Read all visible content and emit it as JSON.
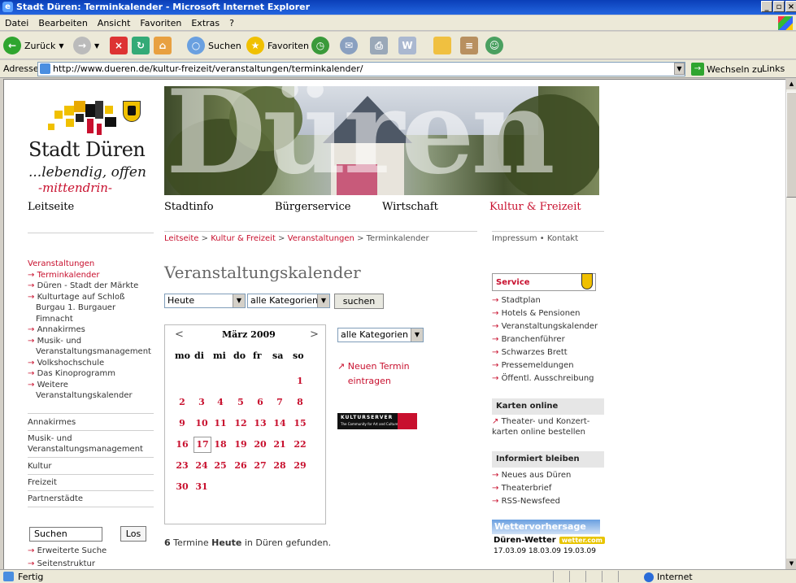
{
  "window": {
    "title": "Stadt Düren: Terminkalender - Microsoft Internet Explorer"
  },
  "menu": [
    "Datei",
    "Bearbeiten",
    "Ansicht",
    "Favoriten",
    "Extras",
    "?"
  ],
  "toolbar": {
    "back": "Zurück",
    "search": "Suchen",
    "favorites": "Favoriten"
  },
  "address": {
    "label": "Adresse",
    "url": "http://www.dueren.de/kultur-freizeit/veranstaltungen/terminkalender/",
    "go": "Wechseln zu",
    "links": "Links"
  },
  "status": {
    "text": "Fertig",
    "zone": "Internet"
  },
  "logo": {
    "name": "Stadt Düren",
    "slogan1": "...lebendig, offen",
    "slogan2": "-mittendrin-"
  },
  "banner": {
    "word": "Düren"
  },
  "topnav": {
    "home": "Leitseite",
    "stadtinfo": "Stadtinfo",
    "buerger": "Bürgerservice",
    "wirtschaft": "Wirtschaft",
    "kultur": "Kultur & Freizeit"
  },
  "breadcrumb": {
    "home": "Leitseite",
    "kultur": "Kultur & Freizeit",
    "veranst": "Veranstaltungen",
    "sep": " > ",
    "current": "Terminkalender"
  },
  "rightlinks": "Impressum • Kontakt",
  "leftnav": {
    "heading": "Veranstaltungen",
    "items": [
      "Terminkalender",
      "Düren - Stadt der Märkte",
      "Kulturtage auf Schloß Burgau 1. Burgauer Fimnacht",
      "Annakirmes",
      "Musik- und Veranstaltungsmanagement",
      "Volkshochschule",
      "Das Kinoprogramm",
      "Weitere Veranstaltungskalender"
    ],
    "sections": [
      "Annakirmes",
      "Musik- und Veranstaltungsmanagement",
      "Kultur",
      "Freizeit",
      "Partnerstädte"
    ]
  },
  "search": {
    "value": "Suchen",
    "button": "Los",
    "links": [
      "Erweiterte Suche",
      "Seitenstruktur"
    ]
  },
  "main": {
    "title": "Veranstaltungskalender",
    "period": "Heute",
    "category": "alle Kategorien",
    "submit": "suchen",
    "category2": "alle Kategorien",
    "new_event_arrow": "↗",
    "new_event": "Neuen Termin eintragen",
    "found_count": "6",
    "found_mid": " Termine ",
    "found_today": "Heute",
    "found_end": " in Düren gefunden."
  },
  "kulturserver": {
    "name": "KULTURSERVER",
    "sub": "The Community for Art and Culture"
  },
  "calendar": {
    "month": "März 2009",
    "prev": "<",
    "next": ">",
    "weekdays": [
      "mo",
      "di",
      "mi",
      "do",
      "fr",
      "sa",
      "so"
    ],
    "weeks": [
      [
        "",
        "",
        "",
        "",
        "",
        "",
        "1"
      ],
      [
        "2",
        "3",
        "4",
        "5",
        "6",
        "7",
        "8"
      ],
      [
        "9",
        "10",
        "11",
        "12",
        "13",
        "14",
        "15"
      ],
      [
        "16",
        "17",
        "18",
        "19",
        "20",
        "21",
        "22"
      ],
      [
        "23",
        "24",
        "25",
        "26",
        "27",
        "28",
        "29"
      ],
      [
        "30",
        "31",
        "",
        "",
        "",
        "",
        ""
      ]
    ],
    "today": "17"
  },
  "service": {
    "heading": "Service",
    "items": [
      "Stadtplan",
      "Hotels & Pensionen",
      "Veranstaltungskalender",
      "Branchenführer",
      "Schwarzes Brett",
      "Pressemeldungen",
      "Öffentl. Ausschreibung"
    ]
  },
  "karten": {
    "heading": "Karten online",
    "arrow": "↗",
    "text": "Theater- und Konzert-karten online bestellen"
  },
  "informiert": {
    "heading": "Informiert bleiben",
    "items": [
      "Neues aus Düren",
      "Theaterbrief",
      "RSS-Newsfeed"
    ]
  },
  "weather": {
    "banner": "Wettervorhersage",
    "title": "Düren-Wetter",
    "badge": "wetter.com",
    "dates": "17.03.09  18.03.09  19.03.09"
  },
  "colors": {
    "accent": "#c8102e",
    "titlebar": "#0a3fb8"
  }
}
